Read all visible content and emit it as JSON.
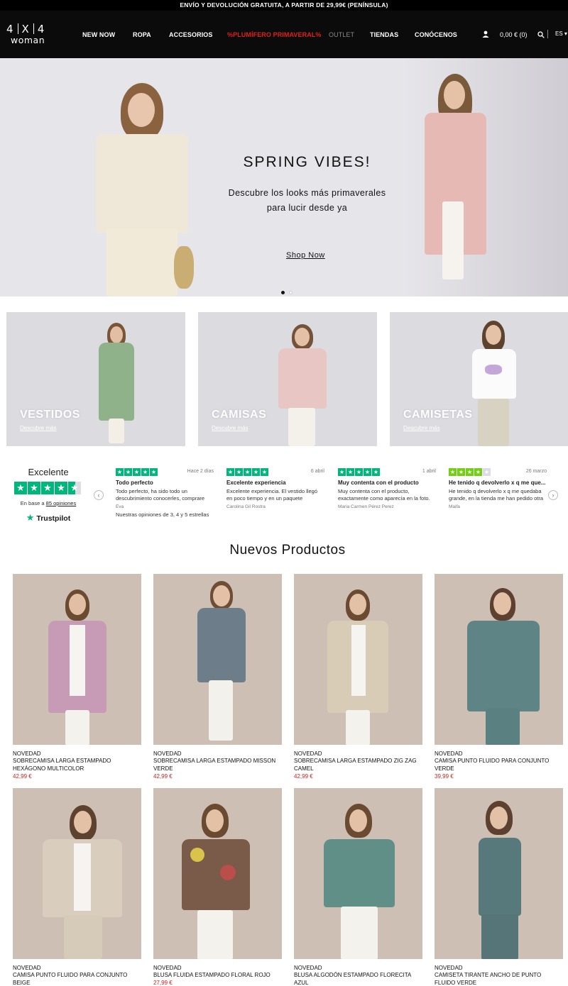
{
  "promo_bar": {
    "text": "ENVÍO Y DEVOLUCIÓN GRATUITA, A PARTIR DE 29,99€ (PENÍNSULA)"
  },
  "header": {
    "logo": {
      "top": "4 | X | 4",
      "bottom": "woman"
    },
    "nav": [
      {
        "label": "NEW NOW",
        "style": "normal"
      },
      {
        "label": "ROPA",
        "style": "normal"
      },
      {
        "label": "ACCESORIOS",
        "style": "normal"
      },
      {
        "label": "%PLUMÍFERO PRIMAVERAL%",
        "style": "highlight",
        "color": "#e02020"
      },
      {
        "label": "OUTLET",
        "style": "muted"
      },
      {
        "label": "TIENDAS",
        "style": "normal"
      },
      {
        "label": "CONÓCENOS",
        "style": "normal"
      }
    ],
    "cart": "0,00 € (0)",
    "language": "ES",
    "icons": [
      "user-icon",
      "search-icon",
      "chevron-down-icon"
    ]
  },
  "hero": {
    "title": "SPRING VIBES!",
    "subtitle_line1": "Descubre los looks más primaverales",
    "subtitle_line2": "para lucir desde ya",
    "cta": "Shop Now",
    "slides_total": 2,
    "active_slide": 1
  },
  "categories": [
    {
      "label": "VESTIDOS",
      "link": "Descubre más"
    },
    {
      "label": "CAMISAS",
      "link": "Descubre más"
    },
    {
      "label": "CAMISETAS",
      "link": "Descubre más"
    }
  ],
  "trustpilot": {
    "rating_word": "Excelente",
    "stars": 4.5,
    "based_on_prefix": "En base a",
    "based_on_count": "85 opiniones",
    "brand": "Trustpilot",
    "reviews": [
      {
        "stars": 5,
        "date": "Hace 2 días",
        "title": "Todo perfecto",
        "text": "Todo perfecto, ha sido todo un descubrimiento conocerles, comprare",
        "author": "Eva"
      },
      {
        "stars": 5,
        "date": "6 abril",
        "title": "Excelente experiencia",
        "text": "Excelente experiencia. El vestido llegó en poco tiempo y en un paquete",
        "author": "Carolina Gil Rostra"
      },
      {
        "stars": 5,
        "date": "1 abril",
        "title": "Muy contenta con el producto",
        "text": "Muy contenta con el producto, exactamente como aparecía en la foto.",
        "author": "Maria Carmen Pérez Perez"
      },
      {
        "stars": 4,
        "date": "26 marzo",
        "title": "He tenido q devolverlo x q me que...",
        "text": "He tenido q devolverlo x q me quedaba grande, en la tienda me han pedido otra",
        "author": "Maifa"
      }
    ],
    "footer_note": "Nuestras opiniones de 3, 4 y 5 estrellas"
  },
  "products_section": {
    "title": "Nuevos Productos",
    "items": [
      {
        "tag": "NOVEDAD",
        "name": "SOBRECAMISA LARGA ESTAMPADO HEXÁGONO MULTICOLOR",
        "price": "42,99 €"
      },
      {
        "tag": "NOVEDAD",
        "name": "SOBRECAMISA LARGA ESTAMPADO MISSON VERDE",
        "price": "42,99 €"
      },
      {
        "tag": "NOVEDAD",
        "name": "SOBRECAMISA LARGA ESTAMPADO ZIG ZAG CAMEL",
        "price": "42,99 €"
      },
      {
        "tag": "NOVEDAD",
        "name": "CAMISA PUNTO FLUIDO PARA CONJUNTO VERDE",
        "price": "39,99 €"
      },
      {
        "tag": "NOVEDAD",
        "name": "CAMISA PUNTO FLUIDO PARA CONJUNTO BEIGE",
        "price": ""
      },
      {
        "tag": "NOVEDAD",
        "name": "BLUSA FLUIDA ESTAMPADO FLORAL ROJO",
        "price": "27,99 €"
      },
      {
        "tag": "NOVEDAD",
        "name": "BLUSA ALGODÓN ESTAMPADO FLORECITA AZUL",
        "price": ""
      },
      {
        "tag": "NOVEDAD",
        "name": "CAMISETA TIRANTE ANCHO DE PUNTO FLUIDO VERDE",
        "price": ""
      }
    ]
  },
  "colors": {
    "accent_red": "#d0211c",
    "trustpilot_green": "#00b67a",
    "header_bg": "#0b0b0b"
  }
}
